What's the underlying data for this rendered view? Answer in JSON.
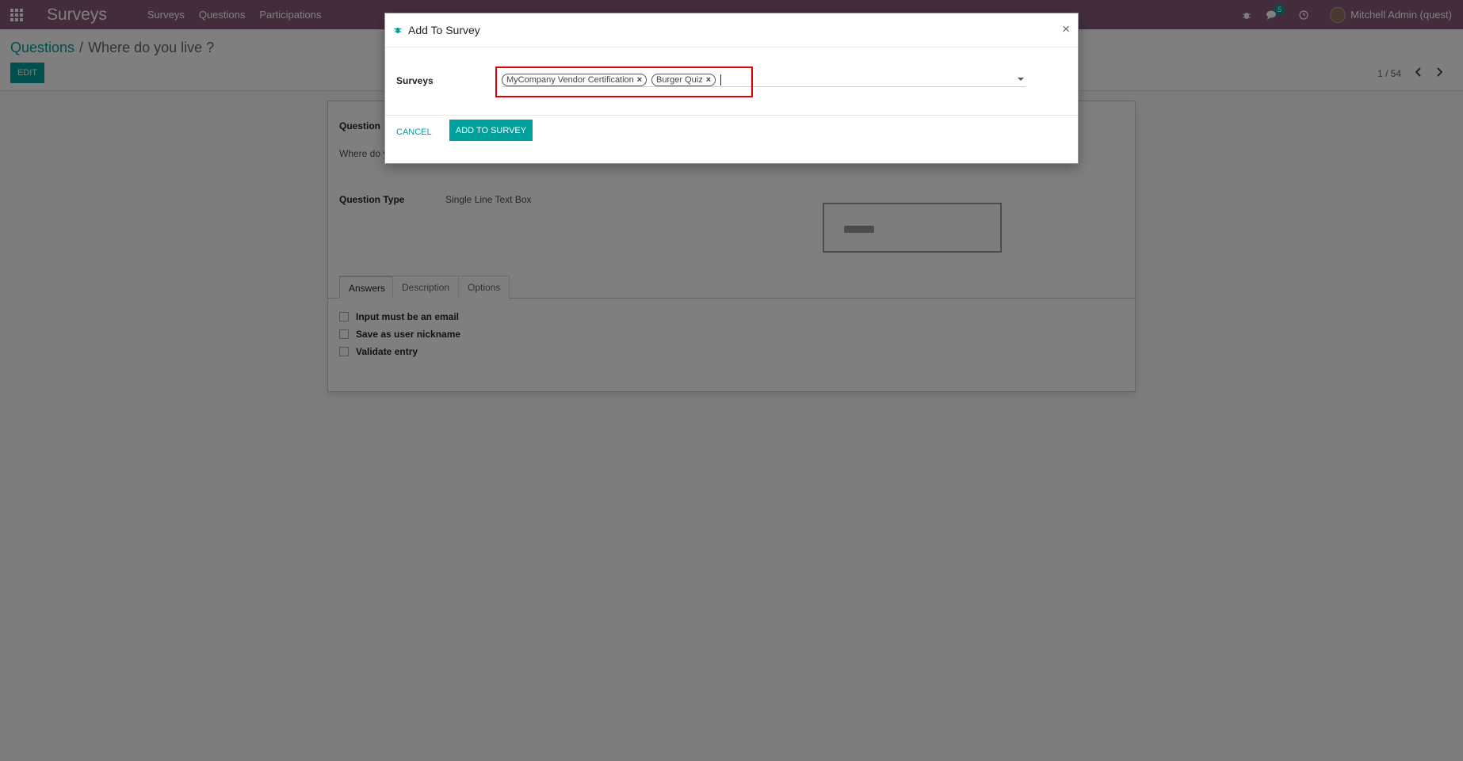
{
  "navbar": {
    "app_name": "Surveys",
    "menu": [
      "Surveys",
      "Questions",
      "Participations"
    ],
    "messages_badge": "5",
    "user_name": "Mitchell Admin (quest)"
  },
  "control_panel": {
    "breadcrumb_root": "Questions",
    "breadcrumb_sep": "/",
    "breadcrumb_current": "Where do you live ?",
    "edit_label": "EDIT",
    "pager_value": "1 / 54"
  },
  "form": {
    "question_label": "Question",
    "question_value": "Where do y",
    "question_type_label": "Question Type",
    "question_type_value": "Single Line Text Box",
    "tabs": [
      "Answers",
      "Description",
      "Options"
    ],
    "checkboxes": [
      "Input must be an email",
      "Save as user nickname",
      "Validate entry"
    ]
  },
  "modal": {
    "title": "Add To Survey",
    "close_glyph": "×",
    "field_label": "Surveys",
    "tags": [
      "MyCompany Vendor Certification",
      "Burger Quiz"
    ],
    "tag_remove_glyph": "×",
    "cancel_label": "CANCEL",
    "add_label": "ADD TO SURVEY"
  },
  "colors": {
    "navbar": "#875a7b",
    "accent": "#00a09d",
    "highlight": "#e00000"
  }
}
